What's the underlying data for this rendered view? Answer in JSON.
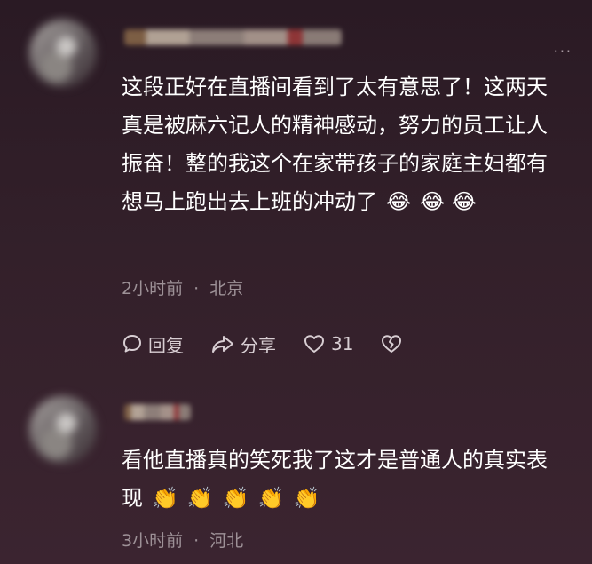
{
  "comments": [
    {
      "text": "这段正好在直播间看到了太有意思了！这两天真是被麻六记人的精神感动，努力的员工让人振奋！整的我这个在家带孩子的家庭主妇都有想马上跑出去上班的冲动了",
      "emojis": [
        "😂",
        "😂",
        "😂"
      ],
      "time": "2小时前",
      "separator": "·",
      "location": "北京",
      "actions": {
        "reply_label": "回复",
        "share_label": "分享",
        "like_count": "31"
      }
    },
    {
      "text": "看他直播真的笑死我了这才是普通人的真实表现",
      "emojis": [
        "👏",
        "👏",
        "👏",
        "👏",
        "👏"
      ],
      "time": "3小时前",
      "separator": "·",
      "location": "河北"
    }
  ],
  "icons": {
    "more": "more-dots-icon",
    "reply": "comment-bubble-icon",
    "share": "share-arrow-icon",
    "like": "heart-icon",
    "dislike": "broken-heart-icon"
  },
  "colors": {
    "text": "#ffffff",
    "meta": "#9d9197",
    "action": "#d8ced3"
  }
}
